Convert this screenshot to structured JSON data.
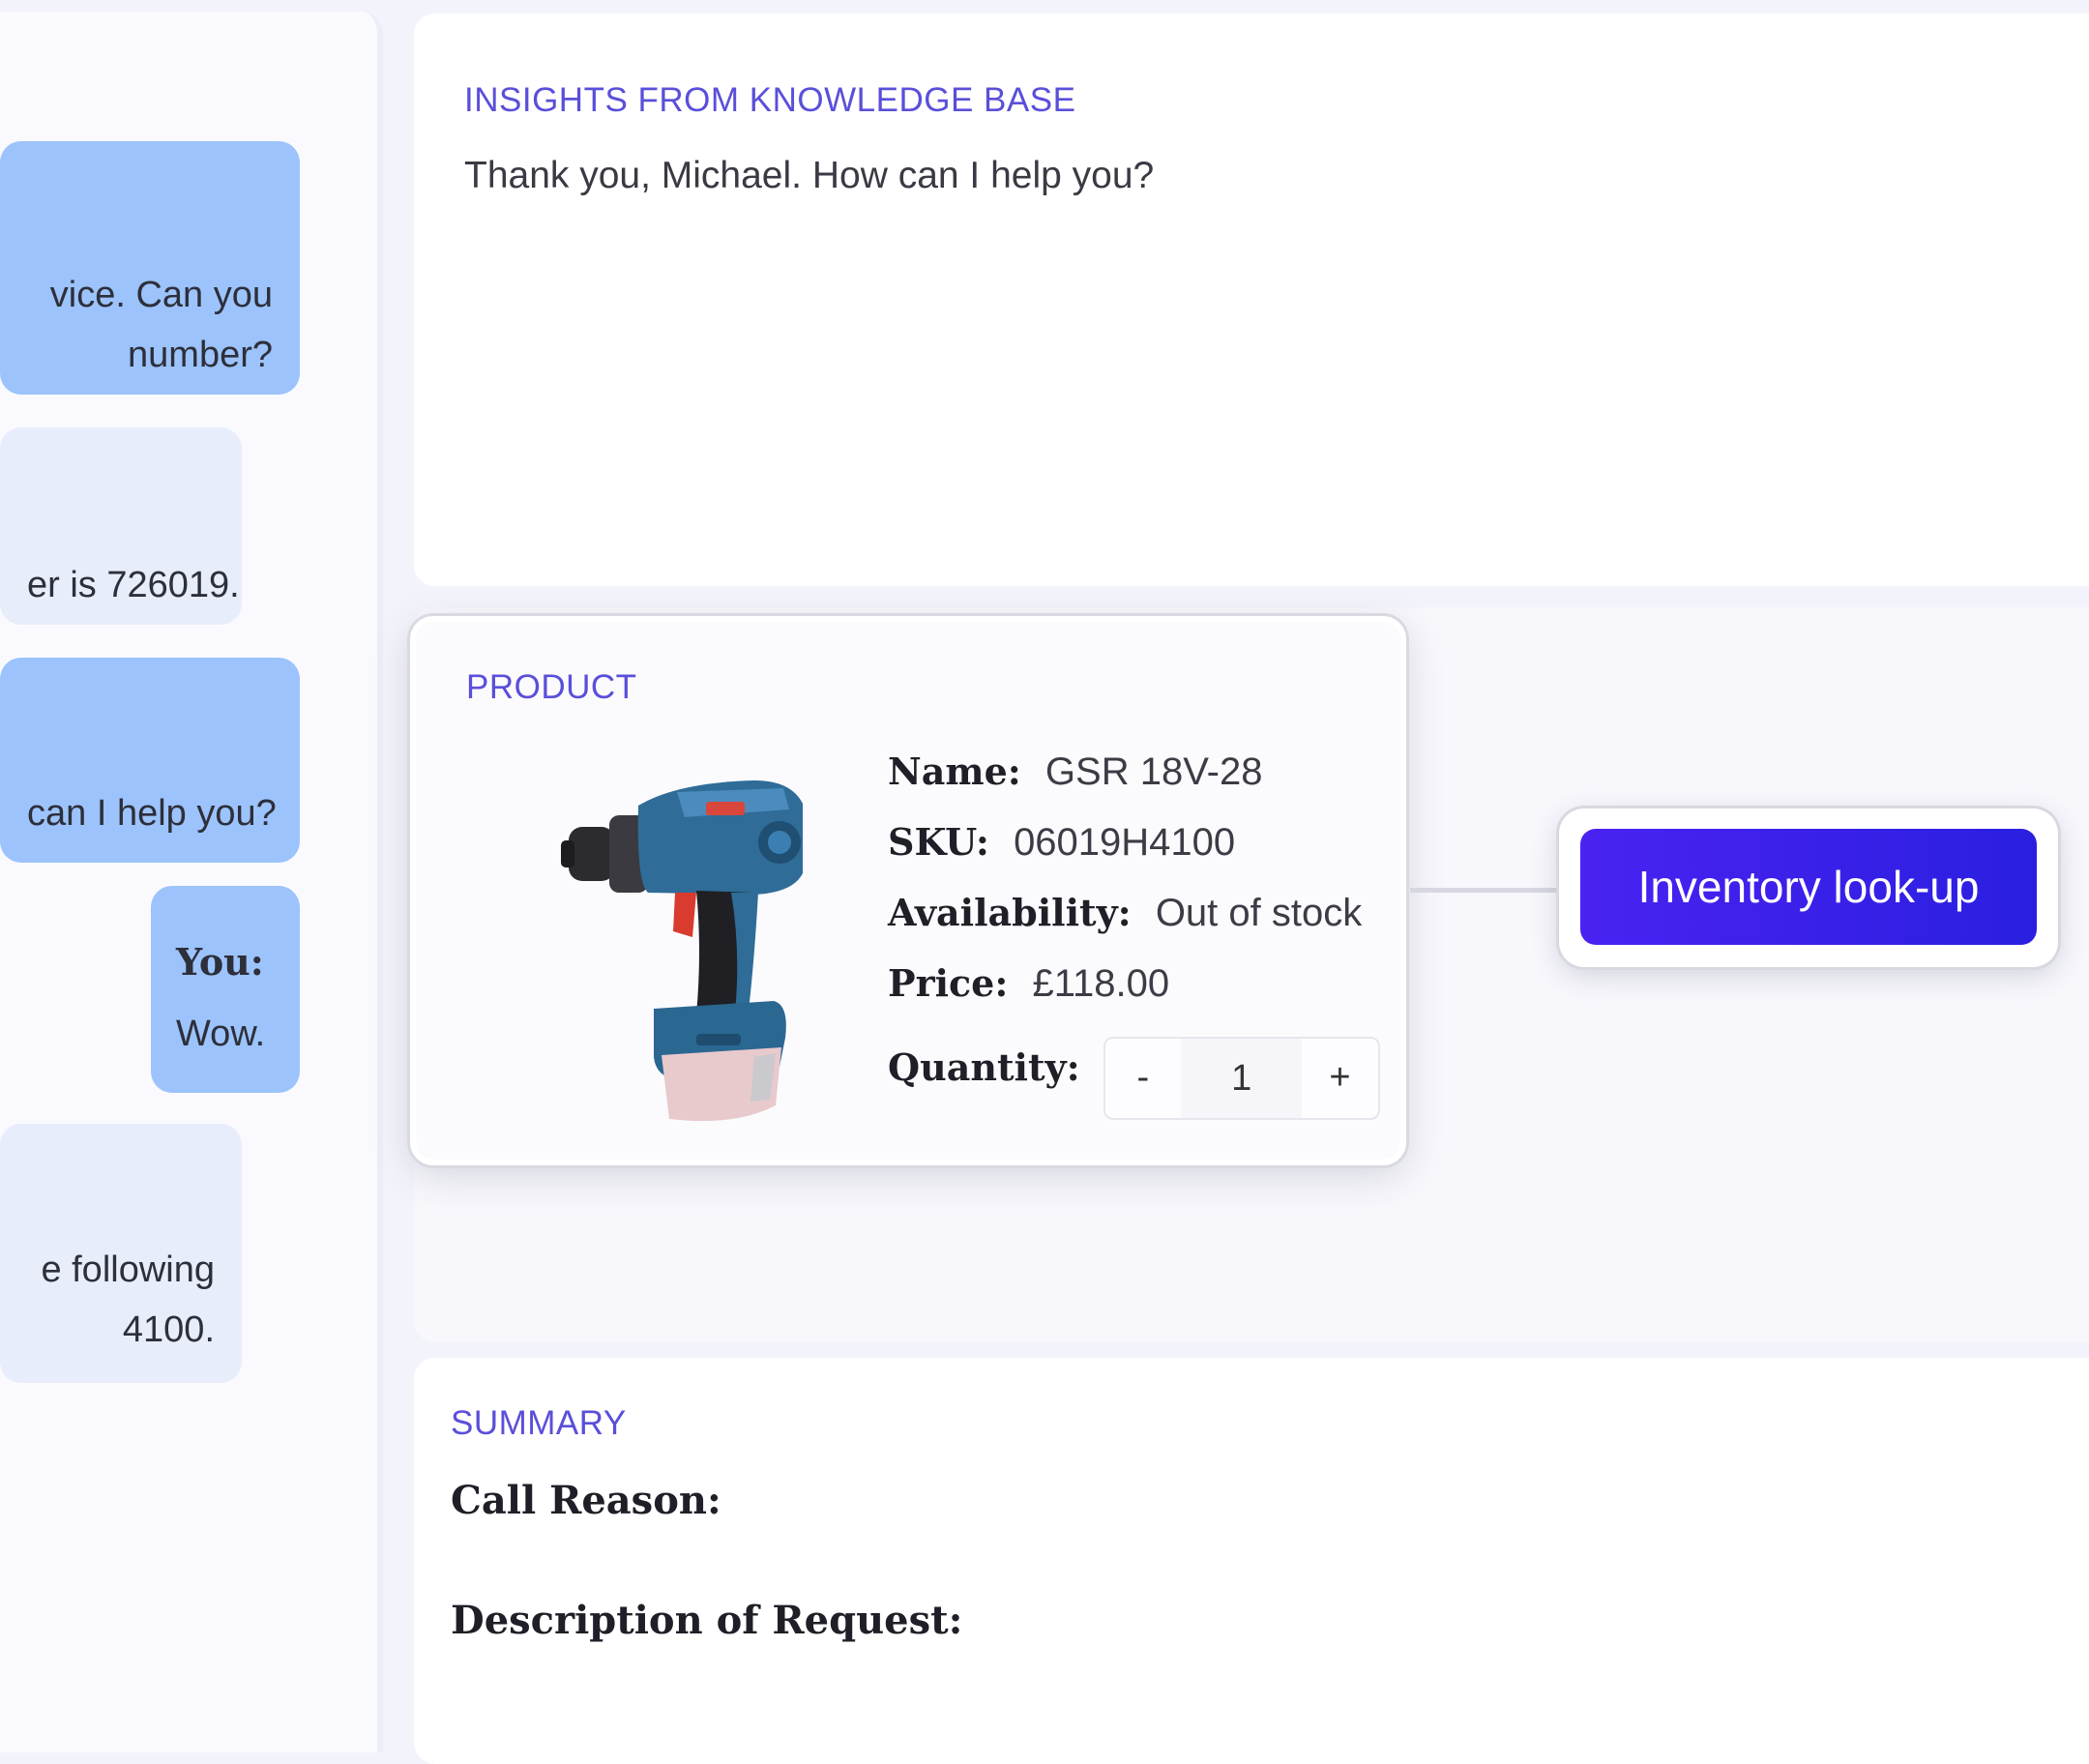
{
  "chat": {
    "messages": [
      {
        "role": "agent",
        "lines": [
          "vice. Can you",
          "number?"
        ]
      },
      {
        "role": "customer",
        "lines": [
          "er is 726019."
        ]
      },
      {
        "role": "agent",
        "lines": [
          "can I help you?"
        ]
      },
      {
        "role": "agent",
        "sender": "You:",
        "lines": [
          "Wow."
        ]
      },
      {
        "role": "customer",
        "lines": [
          "e following",
          "4100."
        ]
      }
    ]
  },
  "insights": {
    "title": "INSIGHTS FROM KNOWLEDGE BASE",
    "text": "Thank you, Michael. How can I help you?"
  },
  "product": {
    "title": "PRODUCT",
    "name_label": "Name:",
    "name": "GSR 18V-28",
    "sku_label": "SKU:",
    "sku": "06019H4100",
    "availability_label": "Availability:",
    "availability": "Out of stock",
    "price_label": "Price:",
    "price": "£118.00",
    "quantity_label": "Quantity:",
    "quantity": "1",
    "decrement": "-",
    "increment": "+",
    "image_icon": "cordless-drill-image"
  },
  "inventory_button": {
    "label": "Inventory look-up",
    "color": "#3a20ea"
  },
  "summary": {
    "title": "SUMMARY",
    "call_reason_label": "Call Reason:",
    "description_label": "Description of Request:"
  },
  "colors": {
    "accent": "#5a4fd9",
    "agent_bubble": "#9cc3fb",
    "customer_bubble": "#e8edfb"
  }
}
